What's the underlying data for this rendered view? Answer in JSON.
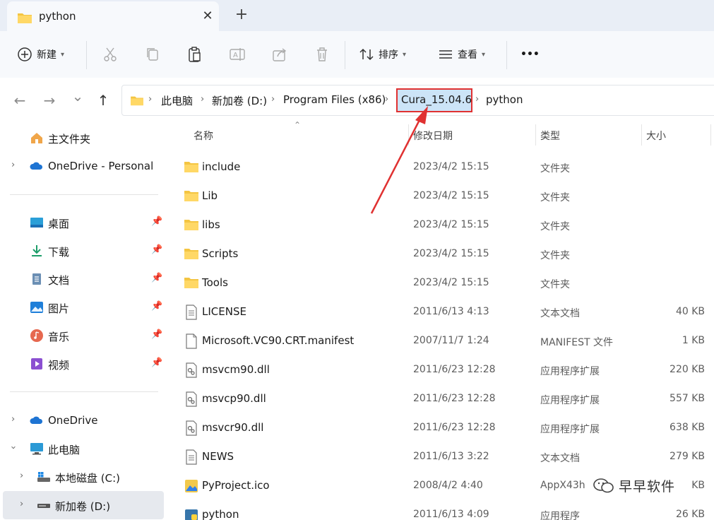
{
  "window": {
    "tab_title": "python",
    "tab_close": "✕",
    "new_tab": "+"
  },
  "toolbar": {
    "new_label": "新建",
    "sort_label": "排序",
    "view_label": "查看",
    "more": "•••"
  },
  "nav": {
    "back": "←",
    "forward": "→",
    "recent": "⌄",
    "up": "↑"
  },
  "breadcrumb": [
    "此电脑",
    "新加卷 (D:)",
    "Program Files (x86)",
    "Cura_15.04.6",
    "python"
  ],
  "sidebar": {
    "home": "主文件夹",
    "onedrive_personal": "OneDrive - Personal",
    "quick": [
      {
        "label": "桌面",
        "icon": "desktop-icon"
      },
      {
        "label": "下载",
        "icon": "download-icon"
      },
      {
        "label": "文档",
        "icon": "document-icon"
      },
      {
        "label": "图片",
        "icon": "picture-icon"
      },
      {
        "label": "音乐",
        "icon": "music-icon"
      },
      {
        "label": "视频",
        "icon": "video-icon"
      }
    ],
    "onedrive": "OneDrive",
    "this_pc": "此电脑",
    "drive_c": "本地磁盘 (C:)",
    "drive_d": "新加卷 (D:)"
  },
  "columns": {
    "name": "名称",
    "date": "修改日期",
    "type": "类型",
    "size": "大小"
  },
  "files": [
    {
      "name": "include",
      "date": "2023/4/2 15:15",
      "type": "文件夹",
      "size": "",
      "icon": "folder-icon"
    },
    {
      "name": "Lib",
      "date": "2023/4/2 15:15",
      "type": "文件夹",
      "size": "",
      "icon": "folder-icon"
    },
    {
      "name": "libs",
      "date": "2023/4/2 15:15",
      "type": "文件夹",
      "size": "",
      "icon": "folder-icon"
    },
    {
      "name": "Scripts",
      "date": "2023/4/2 15:15",
      "type": "文件夹",
      "size": "",
      "icon": "folder-icon"
    },
    {
      "name": "Tools",
      "date": "2023/4/2 15:15",
      "type": "文件夹",
      "size": "",
      "icon": "folder-icon"
    },
    {
      "name": "LICENSE",
      "date": "2011/6/13 4:13",
      "type": "文本文档",
      "size": "40 KB",
      "icon": "text-file-icon"
    },
    {
      "name": "Microsoft.VC90.CRT.manifest",
      "date": "2007/11/7 1:24",
      "type": "MANIFEST 文件",
      "size": "1 KB",
      "icon": "blank-file-icon"
    },
    {
      "name": "msvcm90.dll",
      "date": "2011/6/23 12:28",
      "type": "应用程序扩展",
      "size": "220 KB",
      "icon": "dll-file-icon"
    },
    {
      "name": "msvcp90.dll",
      "date": "2011/6/23 12:28",
      "type": "应用程序扩展",
      "size": "557 KB",
      "icon": "dll-file-icon"
    },
    {
      "name": "msvcr90.dll",
      "date": "2011/6/23 12:28",
      "type": "应用程序扩展",
      "size": "638 KB",
      "icon": "dll-file-icon"
    },
    {
      "name": "NEWS",
      "date": "2011/6/13 3:22",
      "type": "文本文档",
      "size": "279 KB",
      "icon": "text-file-icon"
    },
    {
      "name": "PyProject.ico",
      "date": "2008/4/2 4:40",
      "type": "AppX43h",
      "size": "KB",
      "icon": "image-file-icon"
    },
    {
      "name": "python",
      "date": "2011/6/13 4:09",
      "type": "应用程序",
      "size": "26 KB",
      "icon": "python-exe-icon"
    }
  ],
  "watermark": "早早软件",
  "colors": {
    "highlight_border": "#e03131",
    "highlight_fill": "#cce4f7",
    "annotation_arrow": "#e03131",
    "folder": "#f4c542"
  }
}
